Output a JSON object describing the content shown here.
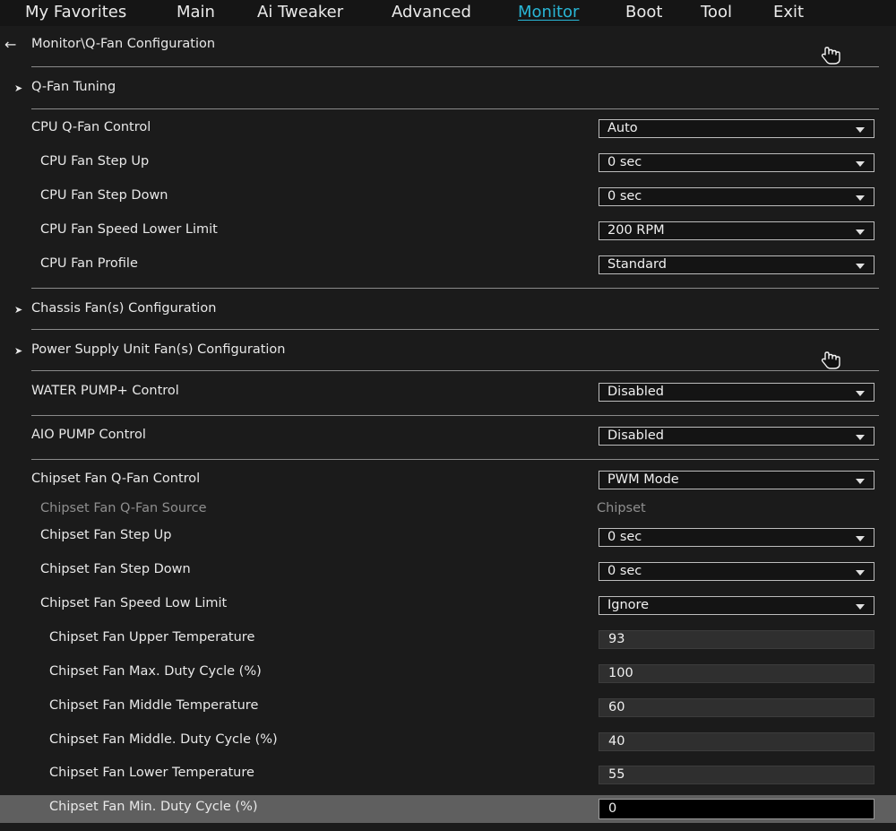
{
  "menu": {
    "tabs": [
      "My Favorites",
      "Main",
      "Ai Tweaker",
      "Advanced",
      "Monitor",
      "Boot",
      "Tool",
      "Exit"
    ],
    "active": "Monitor"
  },
  "breadcrumb": "Monitor\\Q-Fan Configuration",
  "sections": {
    "qfan_tuning": "Q-Fan Tuning",
    "chassis": "Chassis Fan(s) Configuration",
    "psu": "Power Supply Unit Fan(s) Configuration"
  },
  "settings": {
    "cpu_qfan_control": {
      "label": "CPU Q-Fan Control",
      "value": "Auto"
    },
    "cpu_step_up": {
      "label": "CPU Fan Step Up",
      "value": "0 sec"
    },
    "cpu_step_down": {
      "label": "CPU Fan Step Down",
      "value": "0 sec"
    },
    "cpu_speed_lower_limit": {
      "label": "CPU Fan Speed Lower Limit",
      "value": "200 RPM"
    },
    "cpu_profile": {
      "label": "CPU Fan Profile",
      "value": "Standard"
    },
    "water_pump": {
      "label": "WATER PUMP+ Control",
      "value": "Disabled"
    },
    "aio_pump": {
      "label": "AIO PUMP Control",
      "value": "Disabled"
    },
    "chipset_qfan_control": {
      "label": "Chipset Fan Q-Fan Control",
      "value": "PWM Mode"
    },
    "chipset_qfan_source": {
      "label": "Chipset Fan Q-Fan Source",
      "value": "Chipset"
    },
    "chipset_step_up": {
      "label": "Chipset Fan Step Up",
      "value": "0 sec"
    },
    "chipset_step_down": {
      "label": "Chipset Fan Step Down",
      "value": "0 sec"
    },
    "chipset_speed_low_limit": {
      "label": "Chipset Fan Speed Low Limit",
      "value": "Ignore"
    },
    "chipset_upper_temp": {
      "label": "Chipset Fan Upper Temperature",
      "value": "93"
    },
    "chipset_max_duty": {
      "label": "Chipset Fan Max. Duty Cycle (%)",
      "value": "100"
    },
    "chipset_middle_temp": {
      "label": "Chipset Fan Middle Temperature",
      "value": "60"
    },
    "chipset_middle_duty": {
      "label": "Chipset Fan Middle. Duty Cycle (%)",
      "value": "40"
    },
    "chipset_lower_temp": {
      "label": "Chipset Fan Lower Temperature",
      "value": "55"
    },
    "chipset_min_duty": {
      "label": "Chipset Fan Min. Duty Cycle (%)",
      "value": "0"
    }
  },
  "icons": {
    "back": "back-arrow-icon",
    "submenu": "submenu-arrow-icon",
    "cursor": "hand-cursor-icon",
    "dropdown": "chevron-down-icon"
  }
}
